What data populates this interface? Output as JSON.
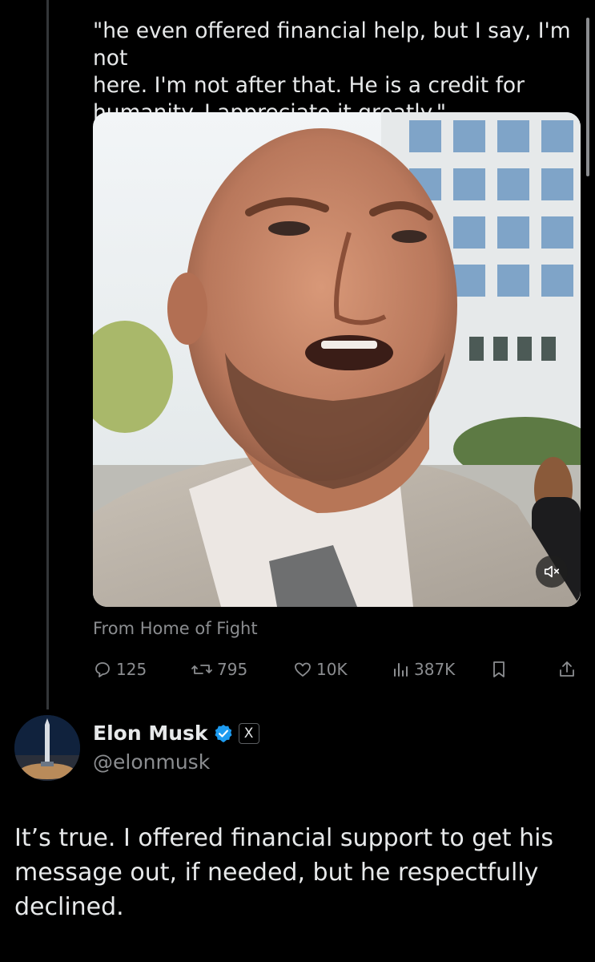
{
  "quoted_tweet": {
    "text": "\"he even offered financial help, but I say, I'm not\nhere. I'm not after that. He is a credit for\nhumanity. I appreciate it greatly.\"",
    "media_source": "From Home of Fight",
    "media_icons": {
      "mute": "volume-muted-icon"
    },
    "actions": {
      "replies": "125",
      "reposts": "795",
      "likes": "10K",
      "views": "387K"
    }
  },
  "reply": {
    "author_name": "Elon Musk",
    "author_handle": "@elonmusk",
    "affiliate_badge": "X",
    "text": "It’s true. I offered financial support to get his\nmessage out, if needed, but he respectfully\ndeclined."
  },
  "colors": {
    "background": "#000000",
    "text_primary": "#e7e9ea",
    "text_secondary": "#8b8d90",
    "verified_blue": "#1d9bf0",
    "thread_line": "#333639"
  }
}
